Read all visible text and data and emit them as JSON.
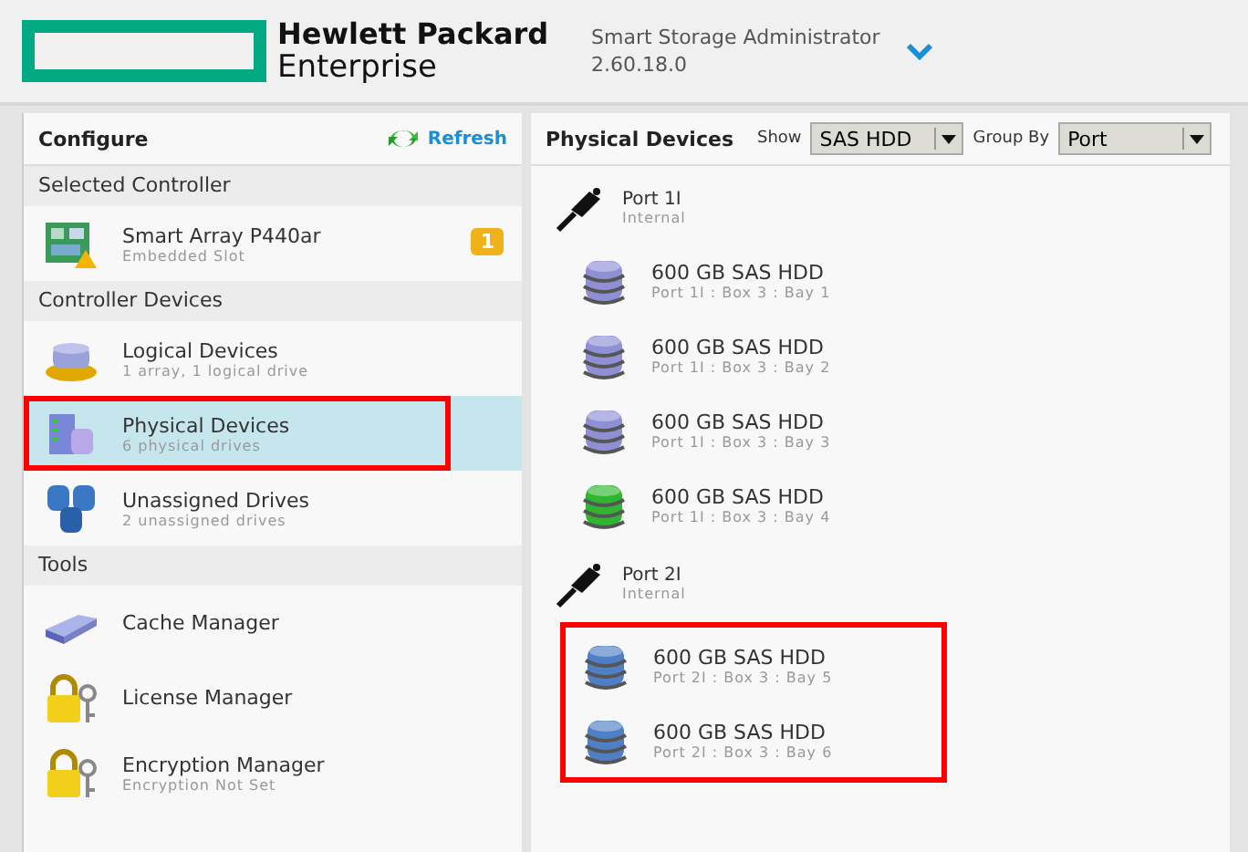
{
  "header": {
    "brand_line_1": "Hewlett Packard",
    "brand_line_2": "Enterprise",
    "app_name": "Smart Storage Administrator",
    "version": "2.60.18.0"
  },
  "configure": {
    "title": "Configure",
    "refresh": "Refresh",
    "sections": [
      {
        "title": "Selected Controller",
        "items": [
          {
            "kind": "controller",
            "title": "Smart Array P440ar",
            "subtitle": "Embedded Slot",
            "badge": "1",
            "selected": false,
            "highlighted": false
          }
        ]
      },
      {
        "title": "Controller Devices",
        "items": [
          {
            "kind": "logical",
            "title": "Logical Devices",
            "subtitle": "1 array, 1 logical drive",
            "selected": false,
            "highlighted": false
          },
          {
            "kind": "physical",
            "title": "Physical Devices",
            "subtitle": "6 physical drives",
            "selected": true,
            "highlighted": true
          },
          {
            "kind": "unassigned",
            "title": "Unassigned Drives",
            "subtitle": "2 unassigned drives",
            "selected": false,
            "highlighted": false
          }
        ]
      },
      {
        "title": "Tools",
        "items": [
          {
            "kind": "cache",
            "title": "Cache Manager",
            "selected": false,
            "highlighted": false
          },
          {
            "kind": "license",
            "title": "License Manager",
            "selected": false,
            "highlighted": false
          },
          {
            "kind": "encryption",
            "title": "Encryption Manager",
            "subtitle": "Encryption Not Set",
            "selected": false,
            "highlighted": false
          }
        ]
      }
    ]
  },
  "physical_devices": {
    "title": "Physical Devices",
    "show_label": "Show",
    "show_value": "SAS HDD",
    "group_label": "Group By",
    "group_value": "Port",
    "ports": [
      {
        "name": "Port 1I",
        "subtitle": "Internal",
        "highlighted": false,
        "drives": [
          {
            "title": "600 GB SAS HDD",
            "location": "Port 1I : Box 3 : Bay 1",
            "color": "#8f8fd6"
          },
          {
            "title": "600 GB SAS HDD",
            "location": "Port 1I : Box 3 : Bay 2",
            "color": "#8f8fd6"
          },
          {
            "title": "600 GB SAS HDD",
            "location": "Port 1I : Box 3 : Bay 3",
            "color": "#8f8fd6"
          },
          {
            "title": "600 GB SAS HDD",
            "location": "Port 1I : Box 3 : Bay 4",
            "color": "#2fb52f"
          }
        ]
      },
      {
        "name": "Port 2I",
        "subtitle": "Internal",
        "highlighted": true,
        "drives": [
          {
            "title": "600 GB SAS HDD",
            "location": "Port 2I : Box 3 : Bay 5",
            "color": "#4f7fc4"
          },
          {
            "title": "600 GB SAS HDD",
            "location": "Port 2I : Box 3 : Bay 6",
            "color": "#4f7fc4"
          }
        ]
      }
    ]
  }
}
